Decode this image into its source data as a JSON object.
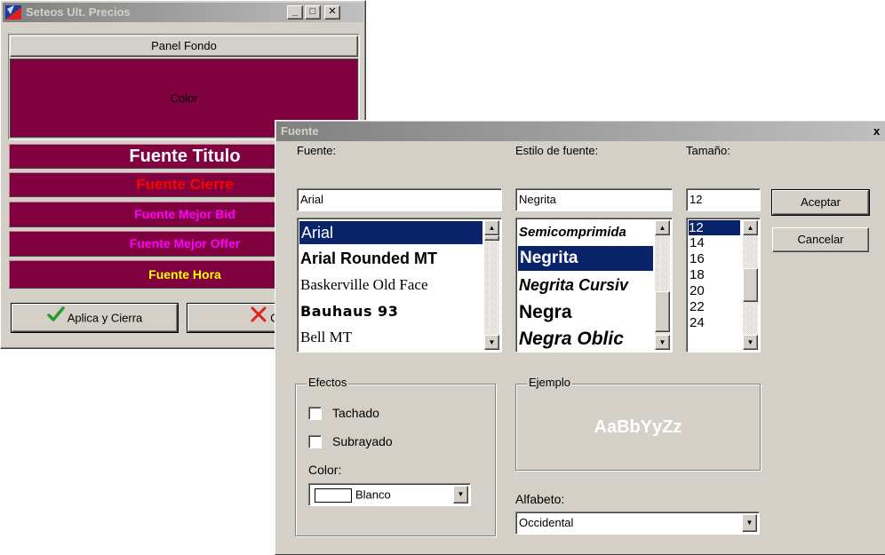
{
  "main_window": {
    "title": "Seteos Ult. Precios",
    "minimize_symbol": "_",
    "maximize_symbol": "□",
    "close_symbol": "✕",
    "panel_header": "Panel Fondo",
    "color_label": "Color",
    "font_bars": [
      {
        "label": "Fuente Titulo",
        "color": "#ffffff"
      },
      {
        "label": "Fuente Cierre",
        "color": "#ff0000"
      },
      {
        "label": "Fuente Mejor Bid",
        "color": "#ff00ff"
      },
      {
        "label": "Fuente Mejor Offer",
        "color": "#ff00ff"
      },
      {
        "label": "Fuente Hora",
        "color": "#ffff00"
      }
    ],
    "apply_button": "Aplica y Cierra",
    "cancel_button": "Can",
    "background_color": "#800040"
  },
  "font_dialog": {
    "title": "Fuente",
    "close_symbol": "x",
    "font_label": "Fuente:",
    "font_value": "Arial",
    "font_list": [
      "Arial",
      "Arial Rounded MT",
      "Baskerville Old Face",
      "Bauhaus 93",
      "Bell MT"
    ],
    "style_label": "Estilo de fuente:",
    "style_value": "Negrita",
    "style_list": [
      "Semicomprimida",
      "Negrita",
      "Negrita Cursiv",
      "Negra",
      "Negra Oblic"
    ],
    "size_label": "Tamaño:",
    "size_value": "12",
    "size_list": [
      "12",
      "14",
      "16",
      "18",
      "20",
      "22",
      "24"
    ],
    "ok_button": "Aceptar",
    "cancel_button": "Cancelar",
    "effects_label": "Efectos",
    "strikeout_label": "Tachado",
    "underline_label": "Subrayado",
    "color_label": "Color:",
    "color_value": "Blanco",
    "sample_label": "Ejemplo",
    "sample_text": "AaBbYyZz",
    "script_label": "Alfabeto:",
    "script_value": "Occidental",
    "selection_color": "#0a246a"
  }
}
